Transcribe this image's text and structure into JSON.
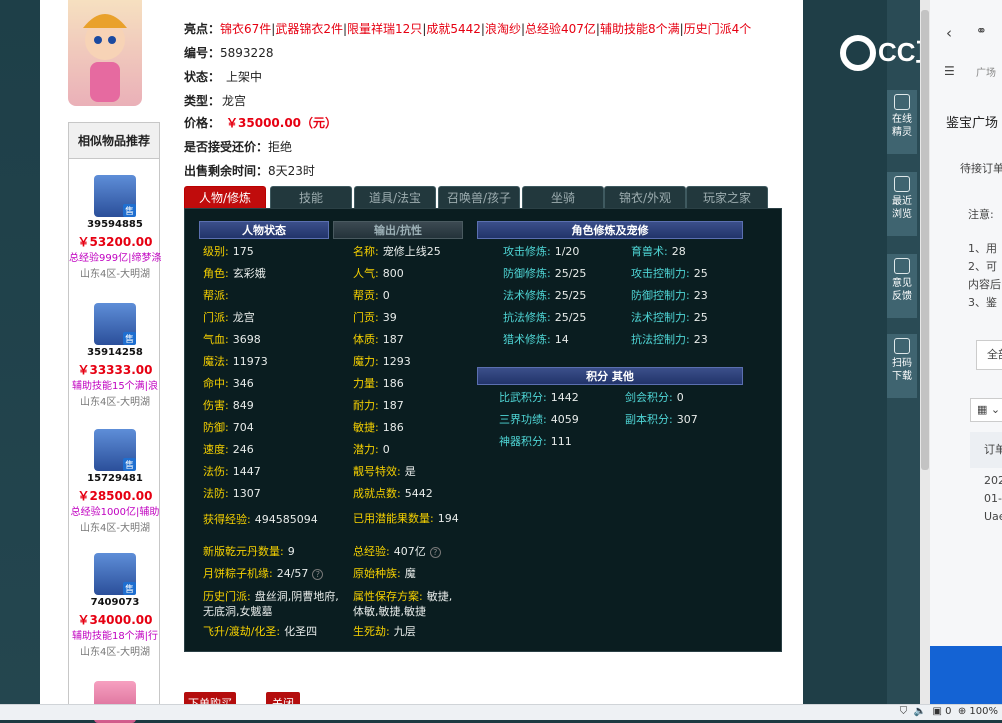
{
  "highlights": {
    "label": "亮点：",
    "items": [
      "锦衣67件",
      "武器锦衣2件",
      "限量祥瑞12只",
      "成就5442",
      "浪淘纱",
      "总经验407亿",
      "辅助技能8个满",
      "历史门派4个"
    ]
  },
  "info": {
    "id_label": "编号：",
    "id": "5893228",
    "status_label": "状态：",
    "status": "上架中",
    "type_label": "类型：",
    "type": "龙宫",
    "price_label": "价格：",
    "price": "￥35000.00（元）",
    "counter_label": "是否接受还价：",
    "counter": "拒绝",
    "remain_label": "出售剩余时间：",
    "remain": "8天23时"
  },
  "tabs": [
    "人物/修炼",
    "技能",
    "道具/法宝",
    "召唤兽/孩子",
    "坐骑",
    "锦衣/外观",
    "玩家之家"
  ],
  "sidebar": {
    "title": "相似物品推荐",
    "sell_badge": "售",
    "items": [
      {
        "id": "39594885",
        "price": "￥53200.00",
        "hl": "总经验999亿|缔梦涤",
        "server": "山东4区-大明湖"
      },
      {
        "id": "35914258",
        "price": "￥33333.00",
        "hl": "辅助技能15个满|浪",
        "server": "山东4区-大明湖"
      },
      {
        "id": "15729481",
        "price": "￥28500.00",
        "hl": "总经验1000亿|辅助",
        "server": "山东4区-大明湖"
      },
      {
        "id": "7409073",
        "price": "￥34000.00",
        "hl": "辅助技能18个满|行",
        "server": "山东4区-大明湖"
      }
    ]
  },
  "panel": {
    "hdr_status": "人物状态",
    "hdr_output": "输出/抗性",
    "hdr_cult": "角色修炼及宠修",
    "hdr_score": "积分 其他",
    "left": [
      [
        "级别:",
        "175"
      ],
      [
        "角色:",
        "玄彩娥"
      ],
      [
        "帮派:",
        ""
      ],
      [
        "门派:",
        "龙宫"
      ],
      [
        "气血:",
        "3698"
      ],
      [
        "魔法:",
        "11973"
      ],
      [
        "命中:",
        "346"
      ],
      [
        "伤害:",
        "849"
      ],
      [
        "防御:",
        "704"
      ],
      [
        "速度:",
        "246"
      ],
      [
        "法伤:",
        "1447"
      ],
      [
        "法防:",
        "1307"
      ],
      [
        "获得经验:",
        "494585094"
      ],
      [
        "新版乾元丹数量:",
        "9"
      ],
      [
        "月饼粽子机缘:",
        "24/57"
      ],
      [
        "历史门派:",
        "盘丝洞,阴曹地府,无底洞,女魃墓"
      ],
      [
        "飞升/渡劫/化圣:",
        "化圣四"
      ]
    ],
    "mid": [
      [
        "名称:",
        "宠修上线25"
      ],
      [
        "人气:",
        "800"
      ],
      [
        "帮贡:",
        "0"
      ],
      [
        "门贡:",
        "39"
      ],
      [
        "体质:",
        "187"
      ],
      [
        "魔力:",
        "1293"
      ],
      [
        "力量:",
        "186"
      ],
      [
        "耐力:",
        "187"
      ],
      [
        "敏捷:",
        "186"
      ],
      [
        "潜力:",
        "0"
      ],
      [
        "靓号特效:",
        "是"
      ],
      [
        "成就点数:",
        "5442"
      ],
      [
        "已用潜能果数量:",
        "194"
      ],
      [
        "总经验:",
        "407亿"
      ],
      [
        "原始种族:",
        "魔"
      ],
      [
        "属性保存方案:",
        "敏捷,体敏,敏捷,敏捷"
      ],
      [
        "生死劫:",
        "九层"
      ]
    ],
    "cult": [
      [
        "攻击修炼:",
        "1/20"
      ],
      [
        "防御修炼:",
        "25/25"
      ],
      [
        "法术修炼:",
        "25/25"
      ],
      [
        "抗法修炼:",
        "25/25"
      ],
      [
        "猎术修炼:",
        "14"
      ]
    ],
    "pet": [
      [
        "育兽术:",
        "28"
      ],
      [
        "攻击控制力:",
        "25"
      ],
      [
        "防御控制力:",
        "23"
      ],
      [
        "法术控制力:",
        "25"
      ],
      [
        "抗法控制力:",
        "23"
      ]
    ],
    "score_l": [
      [
        "比武积分:",
        "1442"
      ],
      [
        "三界功绩:",
        "4059"
      ],
      [
        "神器积分:",
        "111"
      ]
    ],
    "score_r": [
      [
        "剑会积分:",
        "0"
      ],
      [
        "副本积分:",
        "307"
      ]
    ]
  },
  "buttons": {
    "buy": "下单购买",
    "close": "关闭"
  },
  "right_sidebar": [
    {
      "label": "在线精灵"
    },
    {
      "label": "最近浏览"
    },
    {
      "label": "意见反馈"
    },
    {
      "label": "扫码下载"
    }
  ],
  "logo": "CC直播",
  "right_panel": {
    "tab": "广场",
    "title": "鉴宝广场",
    "sub": "待接订单",
    "note": "注意:",
    "l1": "1、用",
    "l2": "2、可",
    "l3": "内容后",
    "l4": "3、鉴",
    "all": "全部",
    "order": "订单",
    "d1": "202",
    "d2": "01-",
    "d3": "Uae"
  },
  "status_bar": {
    "zoom": "100%",
    "count": "0"
  },
  "colors": {
    "accent": "#e60012",
    "tab_active": "#c00c0c",
    "panel_bg": "#0a1d20"
  }
}
